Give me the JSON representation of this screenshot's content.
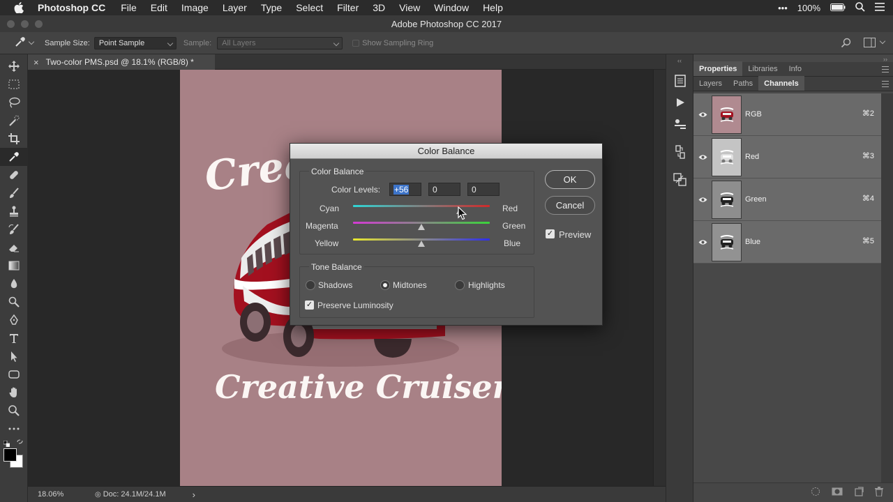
{
  "menubar": {
    "app_name": "Photoshop CC",
    "items": [
      "File",
      "Edit",
      "Image",
      "Layer",
      "Type",
      "Select",
      "Filter",
      "3D",
      "View",
      "Window",
      "Help"
    ],
    "battery": "100%"
  },
  "window": {
    "title": "Adobe Photoshop CC 2017"
  },
  "options": {
    "sample_size_label": "Sample Size:",
    "sample_size_value": "Point Sample",
    "sample_label": "Sample:",
    "sample_value": "All Layers",
    "sampling_ring_label": "Show Sampling Ring"
  },
  "document": {
    "tab_title": "Two-color PMS.psd @ 18.1% (RGB/8) *",
    "zoom": "18.06%",
    "doc_info": "Doc: 24.1M/24.1M",
    "poster_top_text": "Crea",
    "poster_bottom_text": "Creative Cruiser",
    "poster_color": "#a88186"
  },
  "panels": {
    "top_tabs": [
      "Properties",
      "Libraries",
      "Info"
    ],
    "bottom_tabs": [
      "Layers",
      "Paths",
      "Channels"
    ],
    "channels": [
      {
        "name": "RGB",
        "shortcut": "⌘2"
      },
      {
        "name": "Red",
        "shortcut": "⌘3"
      },
      {
        "name": "Green",
        "shortcut": "⌘4"
      },
      {
        "name": "Blue",
        "shortcut": "⌘5"
      }
    ]
  },
  "dialog": {
    "title": "Color Balance",
    "color_balance_group": "Color Balance",
    "color_levels_label": "Color Levels:",
    "levels": [
      "+56",
      "0",
      "0"
    ],
    "sliders": [
      {
        "left": "Cyan",
        "right": "Red",
        "value": 56
      },
      {
        "left": "Magenta",
        "right": "Green",
        "value": 0
      },
      {
        "left": "Yellow",
        "right": "Blue",
        "value": 0
      }
    ],
    "tone_balance_group": "Tone Balance",
    "tones": [
      "Shadows",
      "Midtones",
      "Highlights"
    ],
    "selected_tone": "Midtones",
    "preserve_luminosity_label": "Preserve Luminosity",
    "preserve_luminosity": true,
    "ok_label": "OK",
    "cancel_label": "Cancel",
    "preview_label": "Preview",
    "preview": true
  }
}
